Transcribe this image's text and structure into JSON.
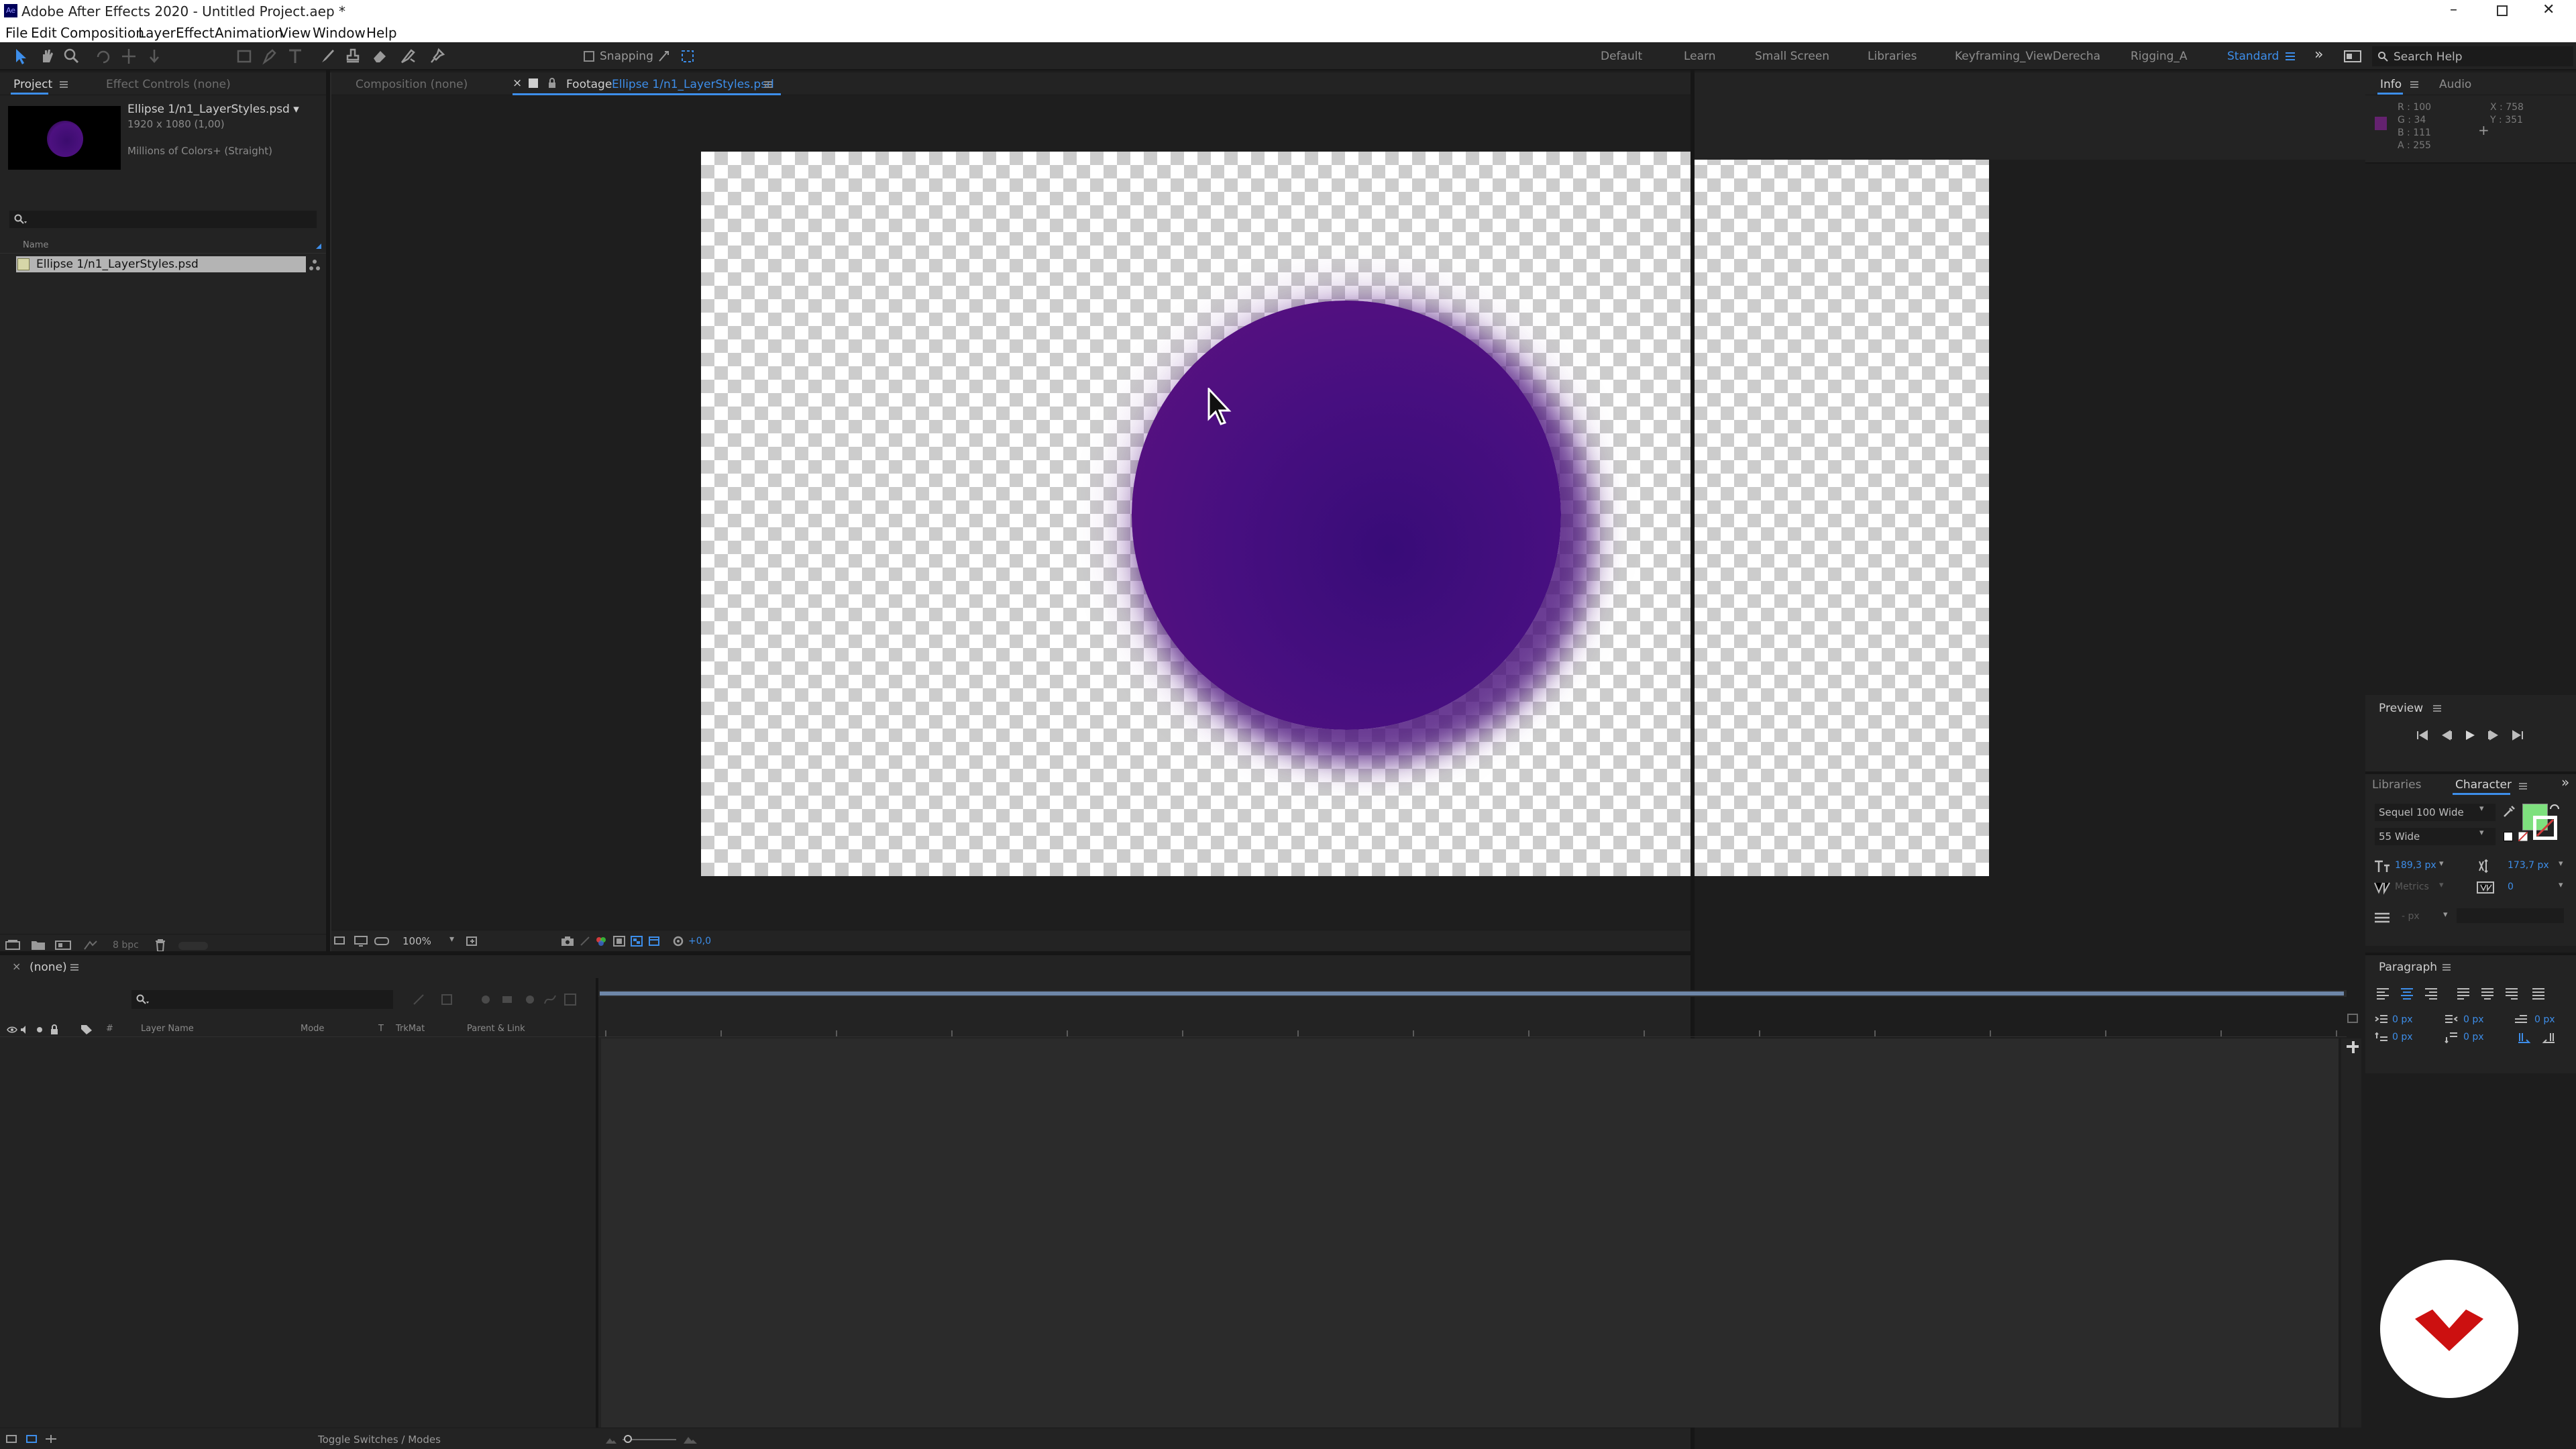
{
  "app": {
    "title": "Adobe After Effects 2020 - Untitled Project.aep *"
  },
  "menu": [
    "File",
    "Edit",
    "Composition",
    "Layer",
    "Effect",
    "Animation",
    "View",
    "Window",
    "Help"
  ],
  "toolbar": {
    "snapping_label": "Snapping"
  },
  "workspaces": [
    "Default",
    "Learn",
    "Small Screen",
    "Libraries",
    "Keyframing_ViewDerecha",
    "Rigging_A",
    "Standard"
  ],
  "search": {
    "placeholder": "Search Help"
  },
  "project_panel": {
    "tab_project": "Project",
    "tab_effect_controls": "Effect Controls (none)",
    "item_title": "Ellipse 1/n1_LayerStyles.psd ▾",
    "item_dims": "1920 x 1080 (1,00)",
    "item_color": "Millions of Colors+ (Straight)",
    "col_name": "Name",
    "row_name": "Ellipse 1/n1_LayerStyles.psd",
    "bpc": "8 bpc"
  },
  "viewer": {
    "tab_composition": "Composition (none)",
    "tab_footage_prefix": "Footage",
    "tab_footage_name": "Ellipse 1/n1_LayerStyles.psd",
    "zoom": "100%",
    "exposure": "+0,0"
  },
  "info_panel": {
    "tab_info": "Info",
    "tab_audio": "Audio",
    "r": "R : 100",
    "g": "G : 34",
    "b": "B : 111",
    "a": "A : 255",
    "x": "X : 758",
    "y": "Y : 351",
    "swatch_color": "#64226f"
  },
  "preview_panel": {
    "tab": "Preview"
  },
  "character_panel": {
    "tab_libraries": "Libraries",
    "tab_character": "Character",
    "font_family": "Sequel 100 Wide",
    "font_style": "55 Wide",
    "font_size": "189,3 px",
    "leading": "173,7 px",
    "kerning": "Metrics",
    "tracking": "0",
    "stroke_unit": "- px",
    "fill_color": "#7ee07e"
  },
  "paragraph_panel": {
    "tab": "Paragraph",
    "indent_left": "0 px",
    "indent_right": "0 px",
    "indent_first": "0 px",
    "space_before": "0 px",
    "space_after": "0 px"
  },
  "timeline": {
    "tab": "(none)",
    "col_layer_name": "Layer Name",
    "col_mode": "Mode",
    "col_t": "T",
    "col_trkmat": "TrkMat",
    "col_parent": "Parent & Link",
    "col_hash": "#",
    "toggle_label": "Toggle Switches / Modes"
  },
  "colors": {
    "accent": "#3d8eea",
    "ellipse": "#4d1180",
    "logo": "#cc1010"
  }
}
